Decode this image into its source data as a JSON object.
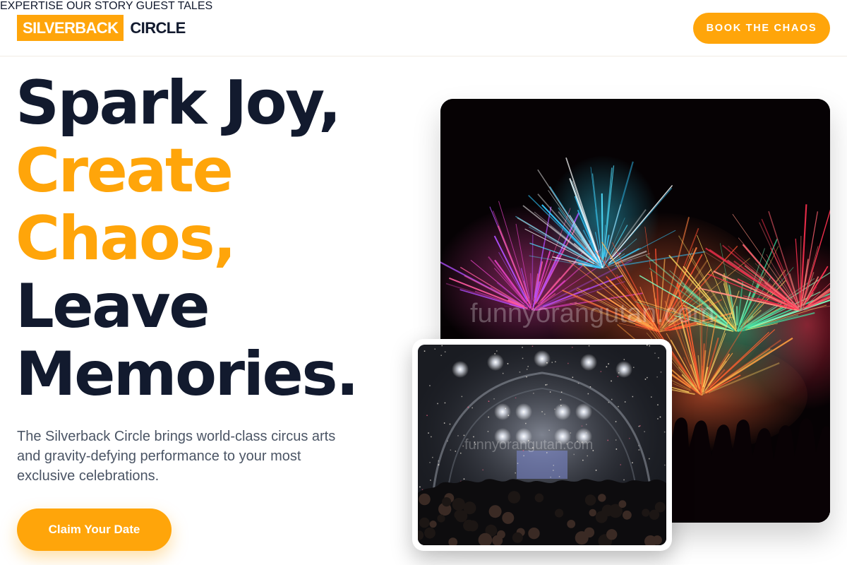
{
  "brand": {
    "highlight": "SILVERBACK",
    "word": "CIRCLE",
    "accent_color": "#ffa50a",
    "dark_color": "#121a2e"
  },
  "nav": {
    "items": [
      {
        "label": "EXPERTISE"
      },
      {
        "label": "OUR STORY"
      },
      {
        "label": "GUEST TALES"
      }
    ],
    "cta_label": "BOOK THE CHAOS"
  },
  "hero": {
    "lines": [
      {
        "text": "Spark Joy,",
        "style": "dark"
      },
      {
        "text": "Create",
        "style": "accent"
      },
      {
        "text": "Chaos,",
        "style": "accent"
      },
      {
        "text": "Leave",
        "style": "dark"
      },
      {
        "text": "Memories.",
        "style": "dark"
      }
    ],
    "description": "The Silverback Circle brings world-class circus arts and gravity-defying performance to your most exclusive celebrations.",
    "cta_label": "Claim Your Date"
  },
  "images": {
    "main": {
      "subject": "fireworks-over-crowd",
      "watermark": "funnyorangutan.com"
    },
    "secondary": {
      "subject": "concert-stage-confetti",
      "watermark": "funnyorangutan.com"
    }
  }
}
